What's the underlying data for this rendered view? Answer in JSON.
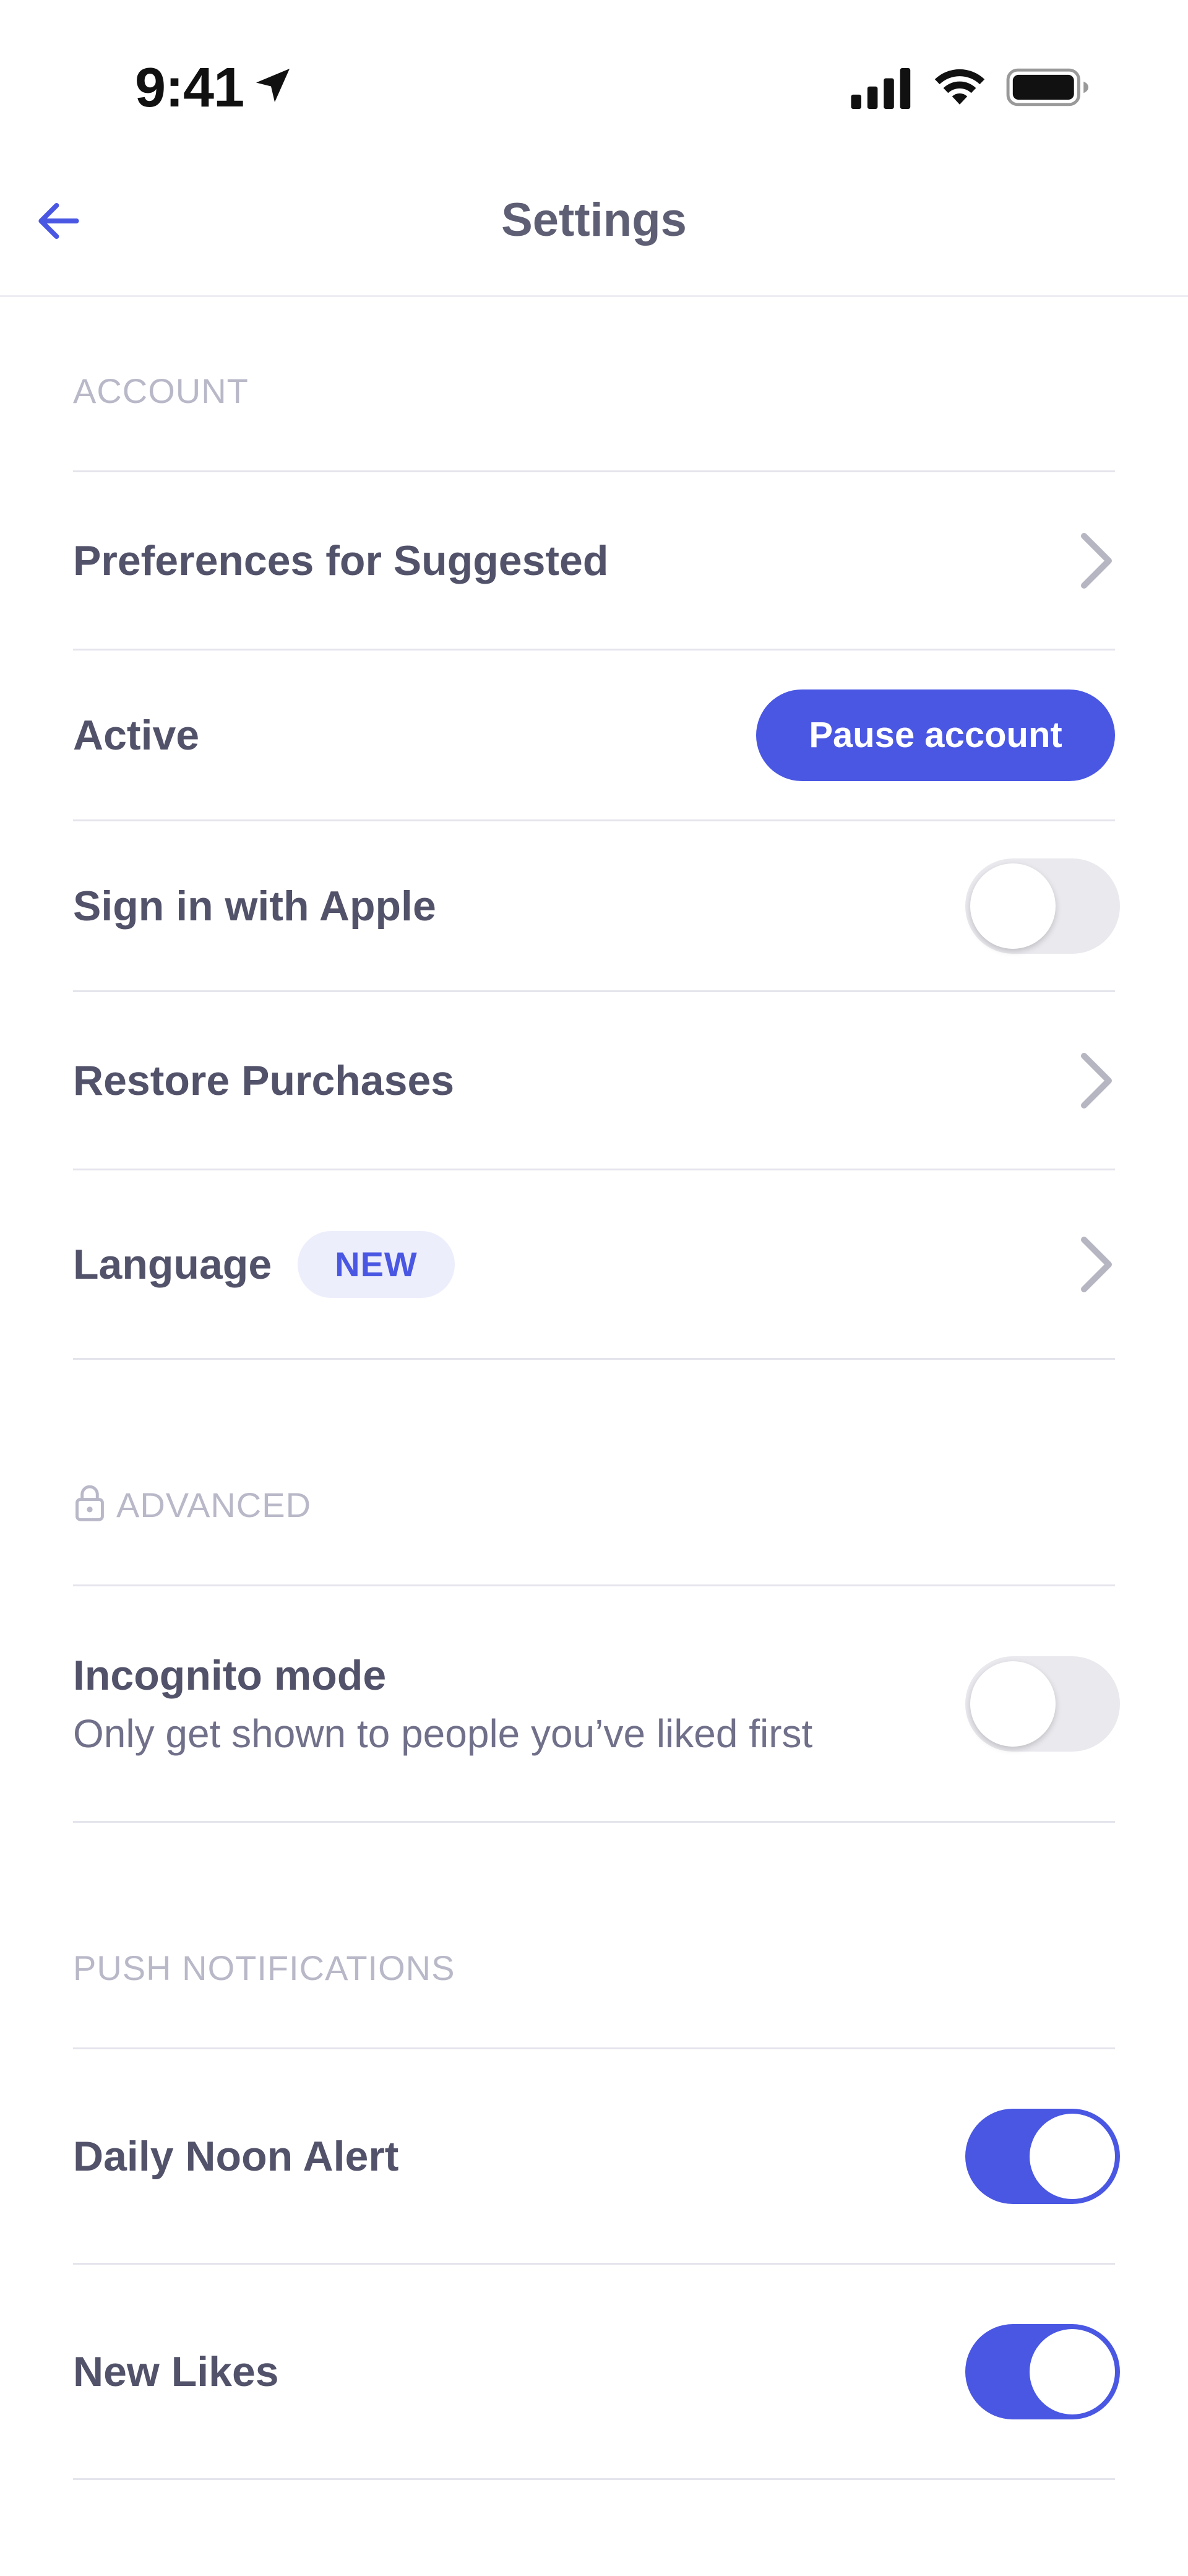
{
  "status_bar": {
    "time": "9:41",
    "icons": [
      "location-arrow-icon",
      "cellular-signal-icon",
      "wifi-icon",
      "battery-icon"
    ]
  },
  "nav": {
    "title": "Settings",
    "back_icon": "arrow-left-icon"
  },
  "sections": {
    "account": {
      "header": "ACCOUNT",
      "preferences_label": "Preferences for Suggested",
      "active_label": "Active",
      "pause_button": "Pause account",
      "apple_label": "Sign in with Apple",
      "apple_enabled": false,
      "restore_label": "Restore Purchases",
      "language_label": "Language",
      "language_badge": "NEW"
    },
    "advanced": {
      "header": "ADVANCED",
      "header_icon": "lock-icon",
      "incognito_label": "Incognito mode",
      "incognito_subtitle": "Only get shown to people you’ve liked first",
      "incognito_enabled": false
    },
    "push": {
      "header": "PUSH NOTIFICATIONS",
      "daily_label": "Daily Noon Alert",
      "daily_enabled": true,
      "likes_label": "New Likes",
      "likes_enabled": true,
      "chats_enabled": true
    }
  },
  "colors": {
    "accent": "#4a57e3",
    "badge_bg": "#eceefb",
    "divider": "#e4e4ec",
    "section_header": "#b8b8c8",
    "label": "#52526a"
  }
}
